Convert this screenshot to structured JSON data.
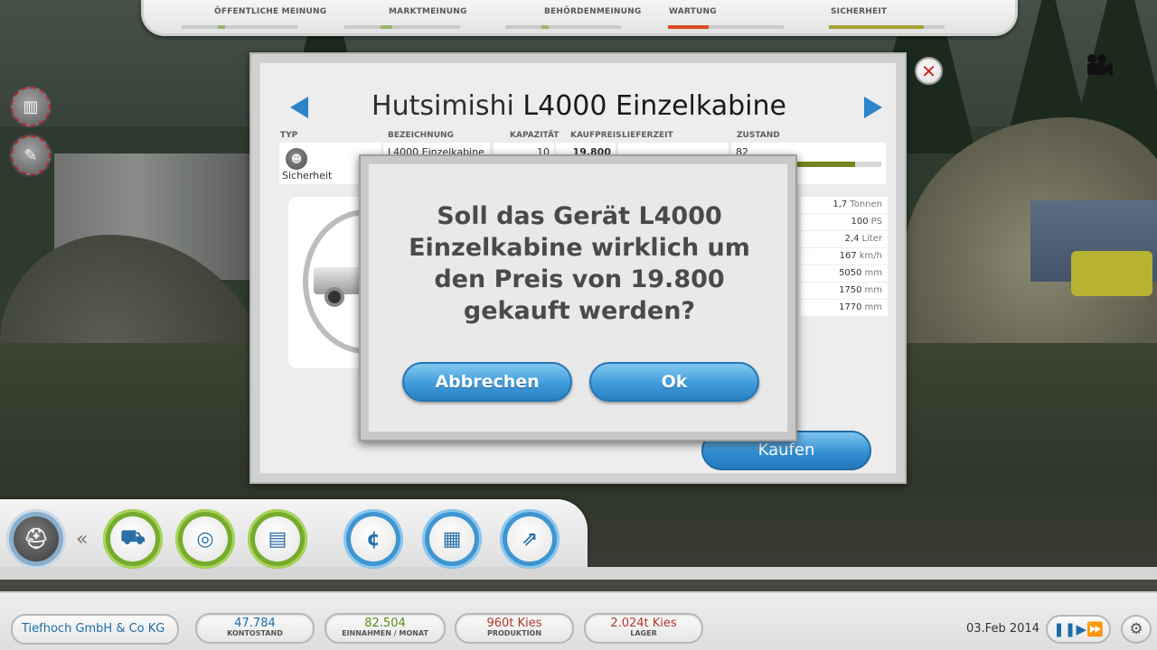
{
  "meters": [
    {
      "label": "ÖFFENTLICHE MEINUNG",
      "level": 0.06,
      "color": "#9ab56a"
    },
    {
      "label": "MARKTMEINUNG",
      "level": 0.1,
      "color": "#9ab56a"
    },
    {
      "label": "BEHÖRDENMEINUNG",
      "level": 0.02,
      "color": "#9ab56a"
    },
    {
      "label": "WARTUNG",
      "level": 0.35,
      "color": "#d94b1f"
    },
    {
      "label": "SICHERHEIT",
      "level": 0.82,
      "color": "#a6a12e"
    }
  ],
  "side_icons": [
    "statistics-icon",
    "wrench-icon"
  ],
  "panel": {
    "title_brand": "Hutsimishi",
    "title_model": "L4000 Einzelkabine",
    "columns": {
      "typ": "TYP",
      "bezeichnung": "BEZEICHNUNG",
      "kapazitaet": "KAPAZITÄT",
      "kaufpreis": "KAUFPREIS",
      "lieferzeit": "LIEFERZEIT",
      "zustand": "ZUSTAND"
    },
    "row": {
      "typ": "Sicherheit",
      "bezeichnung": "L4000 Einzelkabine",
      "kapazitaet": "10",
      "kaufpreis": "19.800",
      "lieferzeit": "",
      "zustand": "82",
      "zustand_level": 0.82
    },
    "specs": [
      {
        "value": "1,7",
        "unit": "Tonnen"
      },
      {
        "value": "100",
        "unit": "PS"
      },
      {
        "value": "2,4",
        "unit": "Liter"
      },
      {
        "value": "167",
        "unit": "km/h"
      },
      {
        "value": "5050",
        "unit": "mm"
      },
      {
        "value": "1750",
        "unit": "mm"
      },
      {
        "value": "1770",
        "unit": "mm"
      }
    ],
    "buy_label": "Kaufen"
  },
  "dialog": {
    "message": "Soll das Gerät L4000 Einzelkabine wirklich um den Preis von 19.800 gekauft werden?",
    "cancel_label": "Abbrechen",
    "ok_label": "Ok"
  },
  "dock": {
    "chevron": "«",
    "buttons": [
      {
        "name": "worker-helmet-icon",
        "glyph": "⛑"
      },
      {
        "name": "truck-icon",
        "glyph": "⛟"
      },
      {
        "name": "tire-icon",
        "glyph": "◎"
      },
      {
        "name": "clipboard-icon",
        "glyph": "▤"
      },
      {
        "name": "finance-icon",
        "glyph": "¢"
      },
      {
        "name": "building-icon",
        "glyph": "▦"
      },
      {
        "name": "growth-arrow-icon",
        "glyph": "⇗"
      }
    ]
  },
  "infobar": {
    "company": "Tiefhoch GmbH & Co KG",
    "stats": [
      {
        "value": "47.784",
        "label": "KONTOSTAND",
        "color": "#1e6fa9"
      },
      {
        "value": "82.504",
        "label": "EINNAHMEN / MONAT",
        "color": "#5b8a1c"
      },
      {
        "value": "960t Kies",
        "label": "PRODUKTION",
        "color": "#b03a2a"
      },
      {
        "value": "2.024t Kies",
        "label": "LAGER",
        "color": "#b03a2a"
      }
    ],
    "date": "03.Feb 2014"
  }
}
